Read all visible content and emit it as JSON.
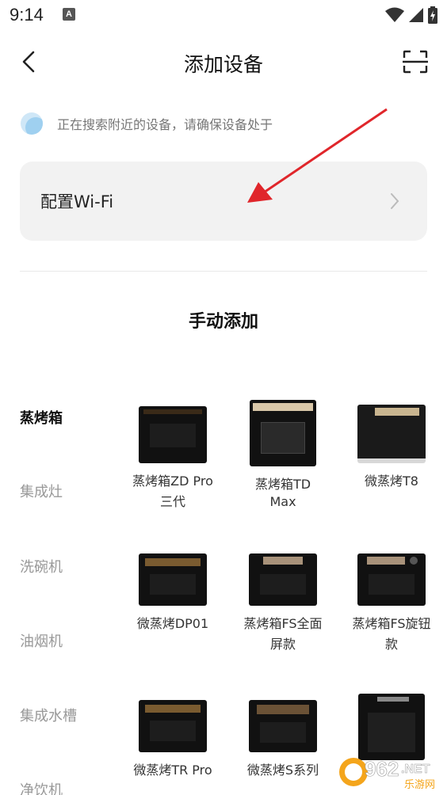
{
  "status_bar": {
    "time": "9:14",
    "notification_letter": "A"
  },
  "header": {
    "title": "添加设备"
  },
  "search_notice": {
    "text": "正在搜索附近的设备，请确保设备处于"
  },
  "wifi_config": {
    "label": "配置Wi-Fi"
  },
  "manual_add": {
    "title": "手动添加"
  },
  "categories": [
    {
      "label": "蒸烤箱",
      "active": true
    },
    {
      "label": "集成灶",
      "active": false
    },
    {
      "label": "洗碗机",
      "active": false
    },
    {
      "label": "油烟机",
      "active": false
    },
    {
      "label": "集成水槽",
      "active": false
    },
    {
      "label": "净饮机",
      "active": false
    }
  ],
  "devices": [
    {
      "name": "蒸烤箱ZD Pro三代",
      "line1": "蒸烤箱ZD Pro",
      "line2": "三代"
    },
    {
      "name": "蒸烤箱TD Max",
      "line1": "蒸烤箱TD",
      "line2": "Max"
    },
    {
      "name": "微蒸烤T8",
      "line1": "微蒸烤T8",
      "line2": ""
    },
    {
      "name": "微蒸烤DP01",
      "line1": "微蒸烤DP01",
      "line2": ""
    },
    {
      "name": "蒸烤箱FS全面屏款",
      "line1": "蒸烤箱FS全面",
      "line2": "屏款"
    },
    {
      "name": "蒸烤箱FS旋钮款",
      "line1": "蒸烤箱FS旋钮",
      "line2": "款"
    },
    {
      "name": "微蒸烤TR Pro",
      "line1": "微蒸烤TR Pro",
      "line2": ""
    },
    {
      "name": "微蒸烤S系列",
      "line1": "微蒸烤S系列",
      "line2": ""
    }
  ],
  "watermark": {
    "number": "962",
    "suffix": ".NET",
    "subtitle": "乐游网"
  },
  "colors": {
    "accent_blue": "#9fd0f0",
    "arrow_red": "#e0262b",
    "card_bg": "#f2f2f2"
  }
}
